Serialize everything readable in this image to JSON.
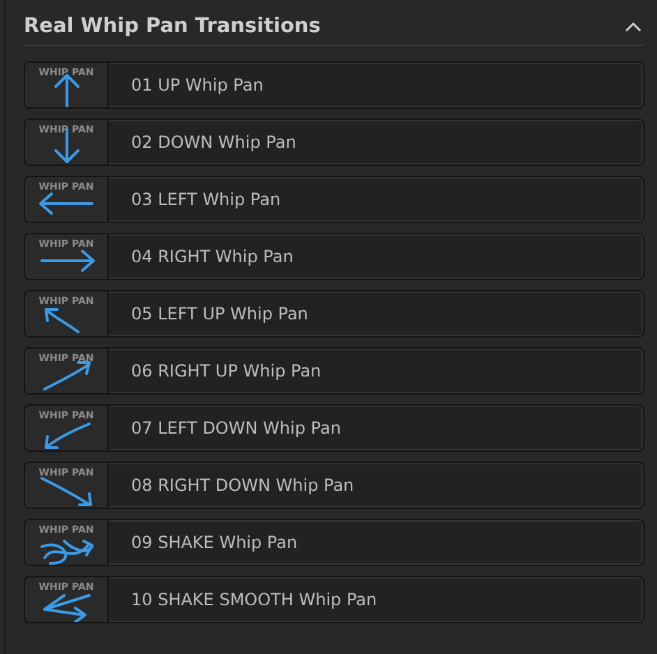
{
  "panel": {
    "title": "Real Whip Pan Transitions",
    "expanded": true
  },
  "items": [
    {
      "badge": "WHIP PAN",
      "kind": "up",
      "label": "01 UP Whip Pan"
    },
    {
      "badge": "WHIP PAN",
      "kind": "down",
      "label": "02 DOWN Whip Pan"
    },
    {
      "badge": "WHIP PAN",
      "kind": "left",
      "label": "03 LEFT Whip Pan"
    },
    {
      "badge": "WHIP PAN",
      "kind": "right",
      "label": "04 RIGHT Whip Pan"
    },
    {
      "badge": "WHIP PAN",
      "kind": "leftup",
      "label": "05 LEFT UP Whip Pan"
    },
    {
      "badge": "WHIP PAN",
      "kind": "rightup",
      "label": "06 RIGHT UP Whip Pan"
    },
    {
      "badge": "WHIP PAN",
      "kind": "leftdown",
      "label": "07 LEFT DOWN Whip Pan"
    },
    {
      "badge": "WHIP PAN",
      "kind": "rightdown",
      "label": "08 RIGHT DOWN Whip Pan"
    },
    {
      "badge": "WHIP PAN",
      "kind": "shake",
      "label": "09 SHAKE Whip Pan"
    },
    {
      "badge": "WHIP PAN",
      "kind": "smooth",
      "label": "10 SHAKE SMOOTH Whip Pan"
    }
  ]
}
